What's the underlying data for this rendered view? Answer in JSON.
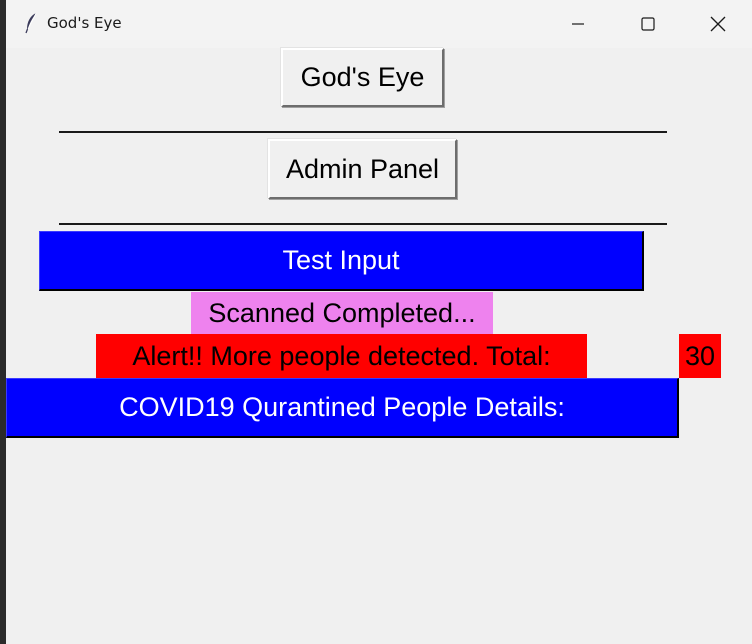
{
  "window": {
    "title": "God's Eye",
    "icon": "feather-icon"
  },
  "controls": {
    "minimize": "minimize-icon",
    "maximize": "maximize-icon",
    "close": "close-icon"
  },
  "main": {
    "gods_eye_button": "God's Eye",
    "admin_panel_button": "Admin Panel",
    "test_input_button": "Test Input",
    "scan_status": "Scanned Completed...",
    "alert_message": "Alert!! More people detected. Total:",
    "people_total": "30",
    "covid_details_button": "COVID19 Qurantined People Details:"
  },
  "colors": {
    "blue_button": "#0000ff",
    "status_violet": "#ee82ee",
    "alert_red": "#ff0000"
  }
}
